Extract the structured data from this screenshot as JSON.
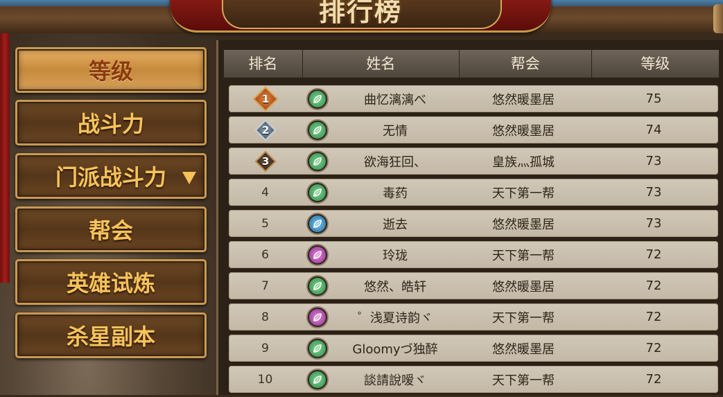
{
  "title": "排行榜",
  "menu": [
    {
      "label": "等级",
      "active": true
    },
    {
      "label": "战斗力",
      "active": false
    },
    {
      "label": "门派战斗力",
      "active": false,
      "has_dropdown": true
    },
    {
      "label": "帮会",
      "active": false
    },
    {
      "label": "英雄试炼",
      "active": false
    },
    {
      "label": "杀星副本",
      "active": false
    }
  ],
  "table": {
    "headers": [
      "排名",
      "姓名",
      "帮会",
      "等级"
    ],
    "rows": [
      {
        "rank": "1",
        "class": "green",
        "name": "曲忆漓漓べ",
        "guild": "悠然暖墨居",
        "level": "75"
      },
      {
        "rank": "2",
        "class": "green",
        "name": "无情",
        "guild": "悠然暖墨居",
        "level": "74"
      },
      {
        "rank": "3",
        "class": "green",
        "name": "欲海狂回、",
        "guild": "皇族灬孤城",
        "level": "73"
      },
      {
        "rank": "4",
        "class": "green",
        "name": "毒药",
        "guild": "天下第一帮",
        "level": "73"
      },
      {
        "rank": "5",
        "class": "blue",
        "name": "逝去",
        "guild": "悠然暖墨居",
        "level": "73"
      },
      {
        "rank": "6",
        "class": "purple",
        "name": "玲珑",
        "guild": "天下第一帮",
        "level": "72"
      },
      {
        "rank": "7",
        "class": "green",
        "name": "悠然、皓轩",
        "guild": "悠然暖墨居",
        "level": "72"
      },
      {
        "rank": "8",
        "class": "purple",
        "name": "゜浅夏诗韵ヾ",
        "guild": "天下第一帮",
        "level": "72"
      },
      {
        "rank": "9",
        "class": "green",
        "name": "Gloomyづ独醉",
        "guild": "悠然暖墨居",
        "level": "72"
      },
      {
        "rank": "10",
        "class": "green",
        "name": "談請說嗳ヾ",
        "guild": "天下第一帮",
        "level": "72"
      }
    ]
  },
  "colors": {
    "menu_text": "#f7c35a",
    "menu_active_bg": "#d9a25a",
    "row_bg": "#c9beac",
    "header_bg": "#5e5449"
  }
}
